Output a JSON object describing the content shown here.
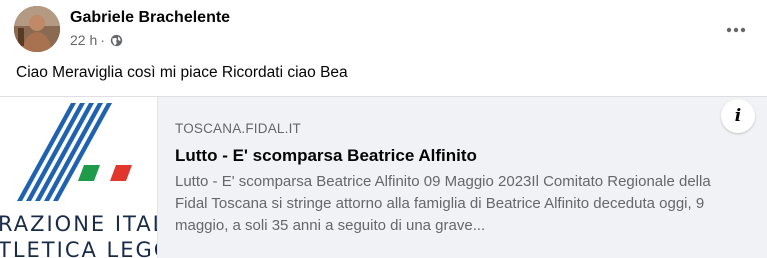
{
  "post": {
    "author": "Gabriele Brachelente",
    "time": "22 h",
    "separator": "·",
    "privacy_icon": "globe-icon",
    "more_icon": "more-horizontal-icon",
    "text": "Ciao Meraviglia così mi piace Ricordati ciao Bea"
  },
  "link_preview": {
    "domain": "TOSCANA.FIDAL.IT",
    "title": "Lutto - E' scomparsa Beatrice Alfinito",
    "description": "Lutto - E' scomparsa Beatrice Alfinito 09 Maggio 2023Il Comitato Regionale della Fidal Toscana si stringe attorno alla famiglia di Beatrice Alfinito deceduta oggi, 9 maggio, a soli 35 anni a seguito di una grave...",
    "info_icon": "info-icon",
    "info_glyph": "i",
    "thumbnail": {
      "logo_line1": "RAZIONE ITAL",
      "logo_line2": "TLETICA LEGG"
    }
  },
  "colors": {
    "stripe_blue": "#1f62b0",
    "flag_green": "#1e9b4a",
    "flag_red": "#e0362c",
    "card_bg": "#f0f2f5",
    "secondary_text": "#65676b"
  }
}
